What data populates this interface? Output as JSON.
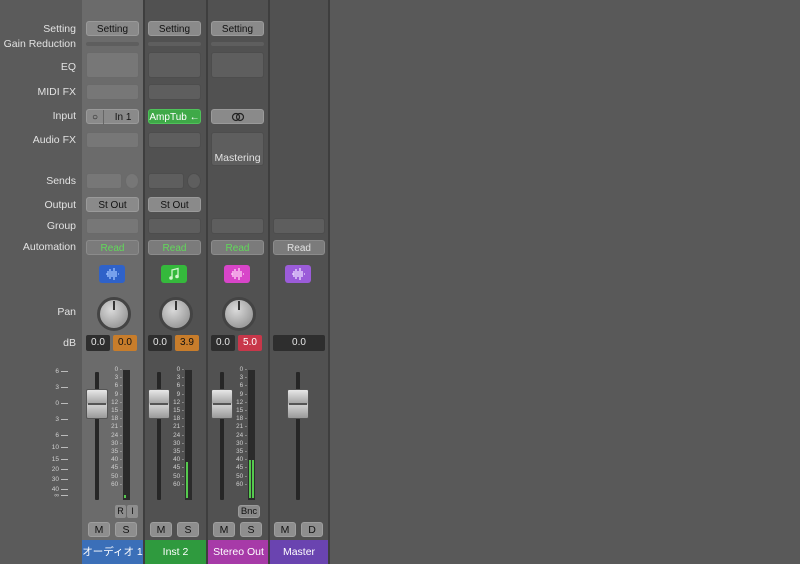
{
  "row_labels": {
    "setting": "Setting",
    "gain_reduction": "Gain Reduction",
    "eq": "EQ",
    "midi_fx": "MIDI FX",
    "input": "Input",
    "audio_fx": "Audio FX",
    "sends": "Sends",
    "output": "Output",
    "group": "Group",
    "automation": "Automation",
    "pan": "Pan",
    "db": "dB"
  },
  "channels": [
    {
      "name": "オーディオ 1",
      "name_color": "#3b6fb8",
      "setting": "Setting",
      "input": "In 1",
      "input_icon": "circle-mono-icon",
      "output": "St Out",
      "automation": "Read",
      "icon": "waveform-icon",
      "icon_color": "#2f62c9",
      "volume": "0.0",
      "peak": "0.0",
      "peak_color": "orange",
      "mute": "M",
      "solo": "S",
      "record": "R",
      "input_monitor": "I"
    },
    {
      "name": "Inst 2",
      "name_color": "#2f9a3e",
      "setting": "Setting",
      "input": "AmpTub",
      "input_icon": "arrow-left-icon",
      "output": "St Out",
      "automation": "Read",
      "icon": "music-note-icon",
      "icon_color": "#35b93c",
      "volume": "0.0",
      "peak": "3.9",
      "peak_color": "orange",
      "mute": "M",
      "solo": "S"
    },
    {
      "name": "Stereo Out",
      "name_color": "#a73aa8",
      "setting": "Setting",
      "input_icon": "stereo-link-icon",
      "audio_fx": "Mastering",
      "automation": "Read",
      "icon": "waveform-icon",
      "icon_color": "#d845c9",
      "volume": "0.0",
      "peak": "5.0",
      "peak_color": "red",
      "mute": "M",
      "solo": "S",
      "bounce": "Bnc"
    },
    {
      "name": "Master",
      "name_color": "#6a44b0",
      "automation": "Read",
      "icon": "waveform-icon",
      "icon_color": "#9b5cd9",
      "volume": "0.0",
      "mute": "M",
      "dim": "D"
    }
  ],
  "fader_scale_left": [
    "6",
    "3",
    "0",
    "3",
    "6",
    "10",
    "15",
    "20",
    "30",
    "40",
    "∞"
  ],
  "meter_scale": [
    "0",
    "3",
    "6",
    "9",
    "12",
    "15",
    "18",
    "21",
    "24",
    "30",
    "35",
    "40",
    "45",
    "50",
    "60"
  ]
}
